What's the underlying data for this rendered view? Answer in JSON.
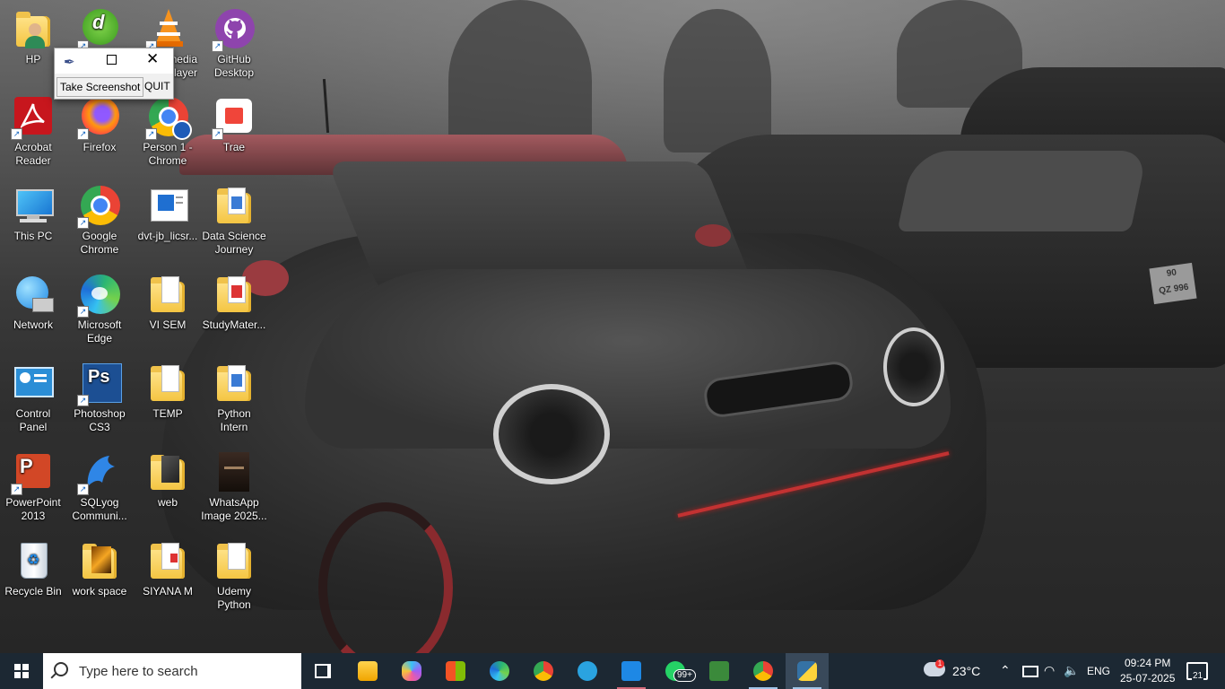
{
  "desktop": {
    "icons": [
      {
        "label": "HP",
        "name": "hp-user-folder"
      },
      {
        "label": "",
        "name": "dreamweaver"
      },
      {
        "label": "media\nlayer",
        "name": "vlc-media-player"
      },
      {
        "label": "GitHub\nDesktop",
        "name": "github-desktop"
      },
      {
        "label": "Acrobat\nReader",
        "name": "acrobat-reader"
      },
      {
        "label": "Firefox",
        "name": "firefox"
      },
      {
        "label": "Person 1 -\nChrome",
        "name": "person-1-chrome"
      },
      {
        "label": "Trae",
        "name": "trae"
      },
      {
        "label": "This PC",
        "name": "this-pc"
      },
      {
        "label": "Google\nChrome",
        "name": "google-chrome"
      },
      {
        "label": "dvt-jb_licsr...",
        "name": "dvt-jb-licsr"
      },
      {
        "label": "Data Science\nJourney",
        "name": "data-science-journey"
      },
      {
        "label": "Network",
        "name": "network"
      },
      {
        "label": "Microsoft\nEdge",
        "name": "microsoft-edge"
      },
      {
        "label": "VI SEM",
        "name": "vi-sem"
      },
      {
        "label": "StudyMater...",
        "name": "study-material"
      },
      {
        "label": "Control\nPanel",
        "name": "control-panel"
      },
      {
        "label": "Photoshop\nCS3",
        "name": "photoshop-cs3"
      },
      {
        "label": "TEMP",
        "name": "temp"
      },
      {
        "label": "Python\nIntern",
        "name": "python-intern"
      },
      {
        "label": "PowerPoint\n2013",
        "name": "powerpoint-2013"
      },
      {
        "label": "SQLyog\nCommuni...",
        "name": "sqlyog-community"
      },
      {
        "label": "web",
        "name": "web"
      },
      {
        "label": "WhatsApp\nImage 2025...",
        "name": "whatsapp-image"
      },
      {
        "label": "Recycle Bin",
        "name": "recycle-bin"
      },
      {
        "label": "work space",
        "name": "work-space"
      },
      {
        "label": "SIYANA M",
        "name": "siyana-m"
      },
      {
        "label": "Udemy\nPython",
        "name": "udemy-python"
      }
    ]
  },
  "app_window": {
    "take_screenshot_label": "Take Screenshot",
    "quit_label": "QUIT"
  },
  "wallpaper": {
    "plate_text": "90\nQZ 996"
  },
  "taskbar": {
    "search_placeholder": "Type here to search",
    "whatsapp_badge": "99+",
    "temperature": "23°C",
    "weather_alert_count": "1",
    "language": "ENG",
    "time": "09:24 PM",
    "date": "25-07-2025",
    "notification_count": "21",
    "colors": {
      "background": "#1c2833",
      "active": "#39495a",
      "underline": "#a0c4e8"
    }
  }
}
